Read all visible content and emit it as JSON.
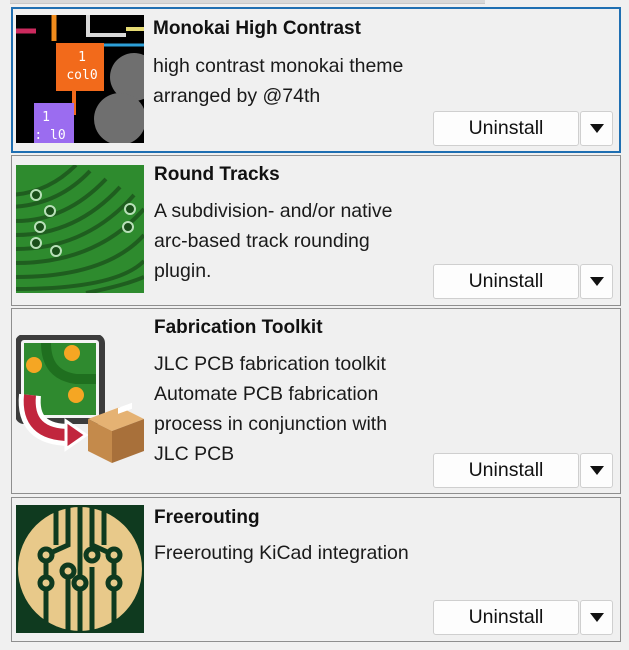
{
  "plugins": [
    {
      "title": "Monokai High Contrast",
      "description_lines": [
        "high contrast monokai theme",
        "arranged by @74th"
      ],
      "action_label": "Uninstall",
      "icon": "monokai-theme-icon",
      "icon_text": [
        "1",
        "col0",
        "1",
        ": l0"
      ]
    },
    {
      "title": "Round Tracks",
      "description_lines": [
        "A subdivision- and/or native",
        "arc-based track rounding",
        "plugin."
      ],
      "action_label": "Uninstall",
      "icon": "round-tracks-icon"
    },
    {
      "title": "Fabrication Toolkit",
      "description_lines": [
        "JLC PCB fabrication toolkit",
        "Automate PCB fabrication",
        "process in conjunction with",
        "JLC PCB"
      ],
      "action_label": "Uninstall",
      "icon": "fabrication-toolkit-icon"
    },
    {
      "title": "Freerouting",
      "description_lines": [
        "Freerouting KiCad integration"
      ],
      "action_label": "Uninstall",
      "icon": "freerouting-icon"
    }
  ],
  "colors": {
    "selection_border": "#1f6fb2",
    "card_border": "#8e8e8e",
    "button_bg": "#fdfdfd"
  }
}
